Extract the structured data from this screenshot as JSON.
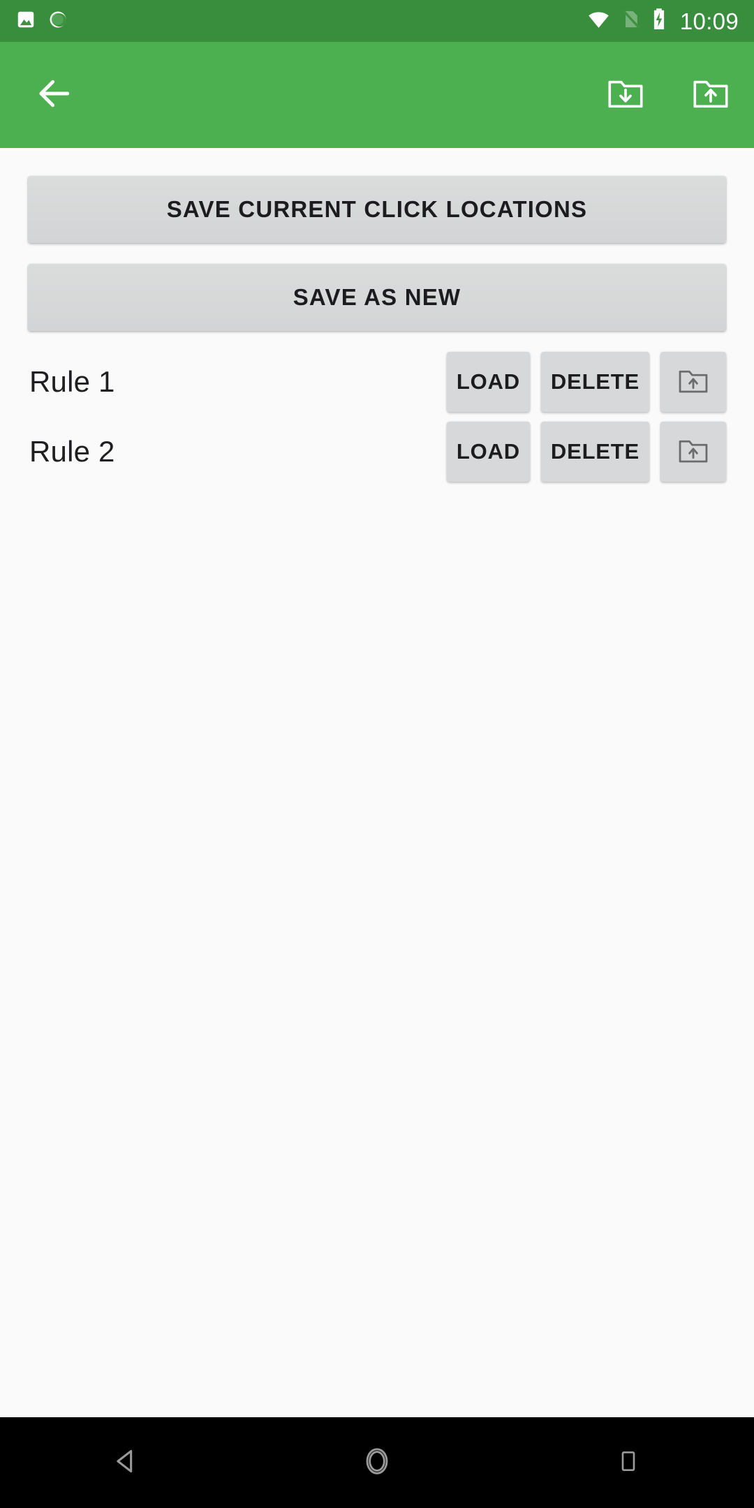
{
  "status_bar": {
    "background_color": "#388E3C",
    "foreground_color": "#FFFFFF",
    "clock": "10:09",
    "left_icons": [
      {
        "name": "image-icon",
        "label": "Screenshot"
      },
      {
        "name": "sync-circle-icon",
        "label": "Sync"
      }
    ],
    "right_icons": [
      {
        "name": "wifi-icon",
        "label": "Wi-Fi connected"
      },
      {
        "name": "no-sim-icon",
        "label": "No SIM"
      },
      {
        "name": "battery-charging-icon",
        "label": "Battery charging"
      }
    ]
  },
  "app_bar": {
    "background_color": "#4CAF50",
    "title": "",
    "back_button_label": "Navigate up",
    "actions": [
      {
        "name": "import-folder-button",
        "label": "Import",
        "icon": "folder-download-icon"
      },
      {
        "name": "export-folder-button",
        "label": "Export",
        "icon": "folder-upload-icon"
      }
    ]
  },
  "main": {
    "background_color": "#FAFAFB",
    "button_color": "#D7D8D9",
    "primary_buttons": [
      {
        "name": "save-current-click-locations-button",
        "label": "SAVE CURRENT CLICK LOCATIONS"
      },
      {
        "name": "save-as-new-button",
        "label": "SAVE AS NEW"
      }
    ],
    "rule_row_actions": {
      "load_label": "LOAD",
      "delete_label": "DELETE",
      "export_icon": "folder-upload-icon",
      "export_label": "Export rule"
    },
    "rules": [
      {
        "name": "Rule 1"
      },
      {
        "name": "Rule 2"
      }
    ]
  },
  "nav_bar": {
    "background_color": "#000000",
    "buttons": [
      {
        "name": "nav-back-button",
        "label": "Back",
        "icon": "triangle-left-icon"
      },
      {
        "name": "nav-home-button",
        "label": "Home",
        "icon": "circle-icon"
      },
      {
        "name": "nav-recents-button",
        "label": "Recents",
        "icon": "square-icon"
      }
    ]
  }
}
